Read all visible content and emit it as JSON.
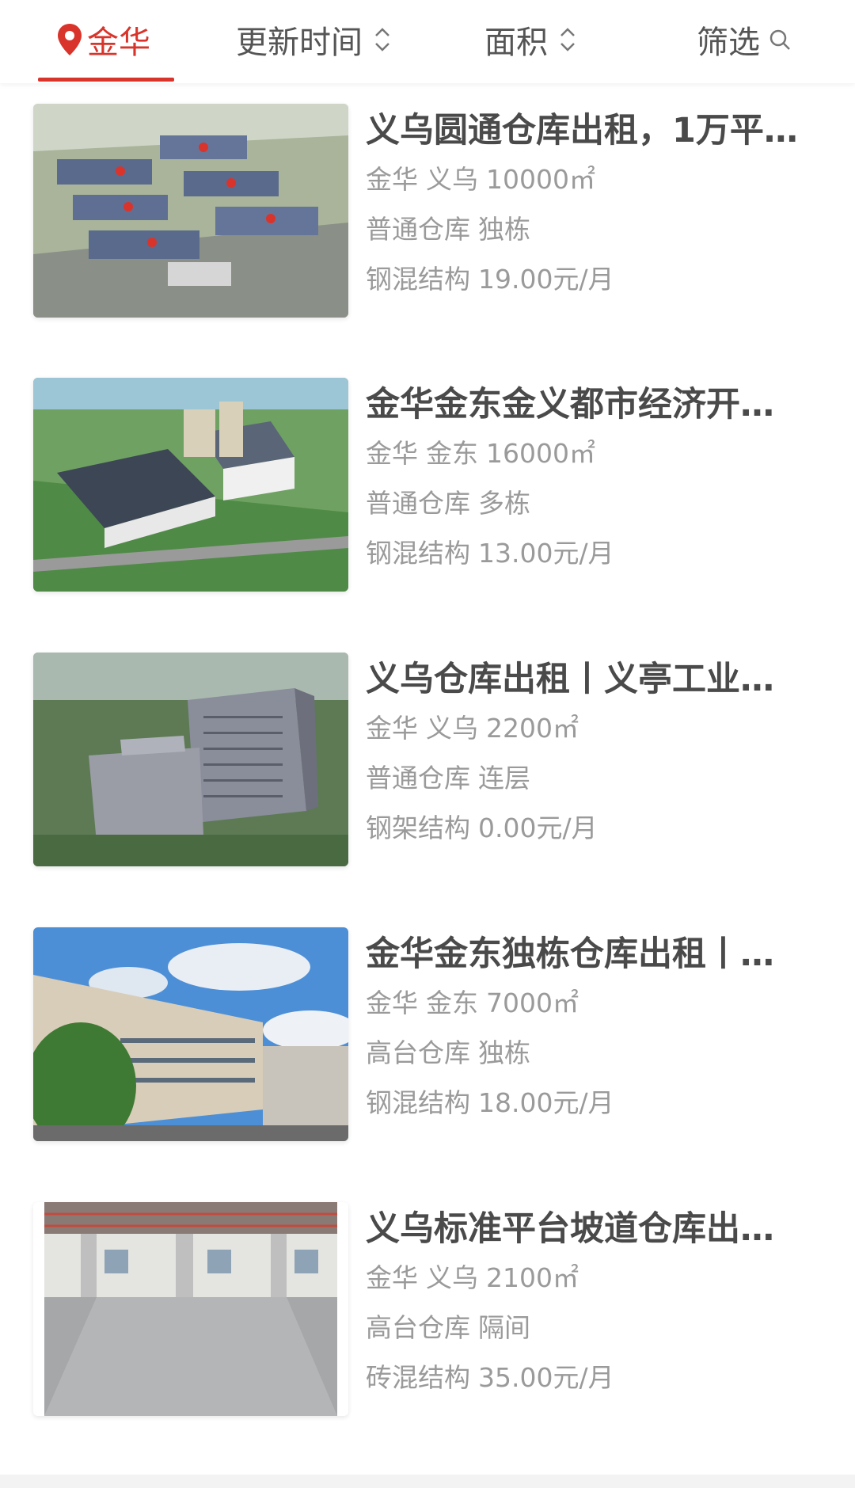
{
  "tabs": {
    "location": "金华",
    "update_time": "更新时间",
    "area": "面积",
    "filter": "筛选"
  },
  "colors": {
    "accent": "#d9342b",
    "title": "#4a4a4a",
    "meta": "#9a9a9a"
  },
  "listings": [
    {
      "title": "义乌圆通仓库出租，1万平…",
      "city": "金华",
      "district": "义乌",
      "area": "10000㎡",
      "type": "普通仓库",
      "building": "独栋",
      "structure": "钢混结构",
      "price": "19.00元/月"
    },
    {
      "title": "金华金东金义都市经济开…",
      "city": "金华",
      "district": "金东",
      "area": "16000㎡",
      "type": "普通仓库",
      "building": "多栋",
      "structure": "钢混结构",
      "price": "13.00元/月"
    },
    {
      "title": "义乌仓库出租丨义亭工业…",
      "city": "金华",
      "district": "义乌",
      "area": "2200㎡",
      "type": "普通仓库",
      "building": "连层",
      "structure": "钢架结构",
      "price": "0.00元/月"
    },
    {
      "title": "金华金东独栋仓库出租丨…",
      "city": "金华",
      "district": "金东",
      "area": "7000㎡",
      "type": "高台仓库",
      "building": "独栋",
      "structure": "钢混结构",
      "price": "18.00元/月"
    },
    {
      "title": "义乌标准平台坡道仓库出…",
      "city": "金华",
      "district": "义乌",
      "area": "2100㎡",
      "type": "高台仓库",
      "building": "隔间",
      "structure": "砖混结构",
      "price": "35.00元/月"
    }
  ]
}
